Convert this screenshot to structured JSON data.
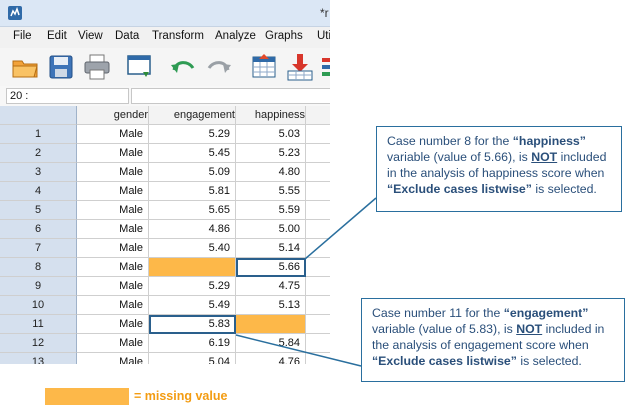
{
  "window": {
    "title": "*r"
  },
  "menu": [
    "File",
    "Edit",
    "View",
    "Data",
    "Transform",
    "Analyze",
    "Graphs",
    "Uti"
  ],
  "toolbar_icons": [
    "open-folder-icon",
    "save-icon",
    "print-icon",
    "dialog-recall-icon",
    "undo-icon",
    "redo-icon",
    "goto-case-icon",
    "goto-variable-icon",
    "variables-icon"
  ],
  "cell_ref": "20 :",
  "table": {
    "columns": [
      "gender",
      "engagement",
      "happiness"
    ],
    "rows": [
      {
        "n": "1",
        "gender": "Male",
        "engagement": "5.29",
        "happiness": "5.03"
      },
      {
        "n": "2",
        "gender": "Male",
        "engagement": "5.45",
        "happiness": "5.23"
      },
      {
        "n": "3",
        "gender": "Male",
        "engagement": "5.09",
        "happiness": "4.80"
      },
      {
        "n": "4",
        "gender": "Male",
        "engagement": "5.81",
        "happiness": "5.55"
      },
      {
        "n": "5",
        "gender": "Male",
        "engagement": "5.65",
        "happiness": "5.59"
      },
      {
        "n": "6",
        "gender": "Male",
        "engagement": "4.86",
        "happiness": "5.00"
      },
      {
        "n": "7",
        "gender": "Male",
        "engagement": "5.40",
        "happiness": "5.14"
      },
      {
        "n": "8",
        "gender": "Male",
        "engagement": "",
        "happiness": "5.66"
      },
      {
        "n": "9",
        "gender": "Male",
        "engagement": "5.29",
        "happiness": "4.75"
      },
      {
        "n": "10",
        "gender": "Male",
        "engagement": "5.49",
        "happiness": "5.13"
      },
      {
        "n": "11",
        "gender": "Male",
        "engagement": "5.83",
        "happiness": ""
      },
      {
        "n": "12",
        "gender": "Male",
        "engagement": "6.19",
        "happiness": "5.84"
      },
      {
        "n": "13",
        "gender": "Male",
        "engagement": "5.04",
        "happiness": "4.76"
      }
    ]
  },
  "callout_happiness": {
    "p1": "Case number 8 for the ",
    "b1": "“happiness”",
    "p2": " variable (value of 5.66), is ",
    "b2": "NOT",
    "p3": " included in the analysis of happiness score when ",
    "b3": "“Exclude cases listwise”",
    "p4": " is selected."
  },
  "callout_engagement": {
    "p1": "Case number 11 for the ",
    "b1": "“engagement”",
    "p2": " variable (value of 5.83), is ",
    "b2": "NOT",
    "p3": " included in the analysis of engagement score when ",
    "b3": "“Exclude cases listwise”",
    "p4": " is selected."
  },
  "legend": {
    "label": "= missing value",
    "color": "#fdb849"
  }
}
